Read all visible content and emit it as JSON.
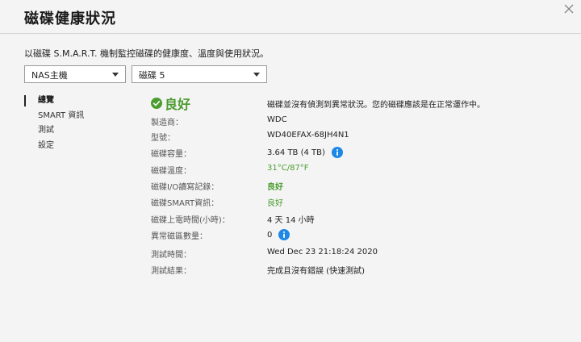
{
  "dialog": {
    "title": "磁碟健康狀況",
    "description": "以磁碟 S.M.A.R.T. 機制監控磁碟的健康度、溫度與使用狀況。"
  },
  "selectors": {
    "device": "NAS主機",
    "disk": "磁碟 5"
  },
  "nav": {
    "items": [
      {
        "label": "總覽",
        "active": true
      },
      {
        "label": "SMART 資訊",
        "active": false
      },
      {
        "label": "測試",
        "active": false
      },
      {
        "label": "設定",
        "active": false
      }
    ]
  },
  "summary": {
    "status": "良好",
    "status_color": "#4b9c2f",
    "message": "磁碟並沒有偵測到異常狀況。您的磁碟應該是在正常運作中。"
  },
  "details": {
    "manufacturer": {
      "label": "製造商：",
      "value": "WDC"
    },
    "model": {
      "label": "型號：",
      "value": "WD40EFAX-68JH4N1"
    },
    "capacity": {
      "label": "磁碟容量：",
      "value": "3.64 TB (4 TB)"
    },
    "temperature": {
      "label": "磁碟溫度：",
      "value": "31°C/87°F"
    },
    "io_log": {
      "label": "磁碟I/O讀寫記錄：",
      "value": "良好"
    },
    "smart": {
      "label": "磁碟SMART資訊：",
      "value": "良好"
    },
    "power_on": {
      "label": "磁碟上電時間(小時)：",
      "value": "4 天 14 小時"
    },
    "bad_sectors": {
      "label": "異常磁區數量：",
      "value": "0"
    },
    "test_time": {
      "label": "測試時間：",
      "value": "Wed Dec 23 21:18:24 2020"
    },
    "test_result": {
      "label": "測試結果：",
      "value": "完成且沒有錯誤 (快速測試)"
    }
  },
  "colors": {
    "accent_green": "#4b9c2f",
    "info_blue": "#1e88e5"
  }
}
